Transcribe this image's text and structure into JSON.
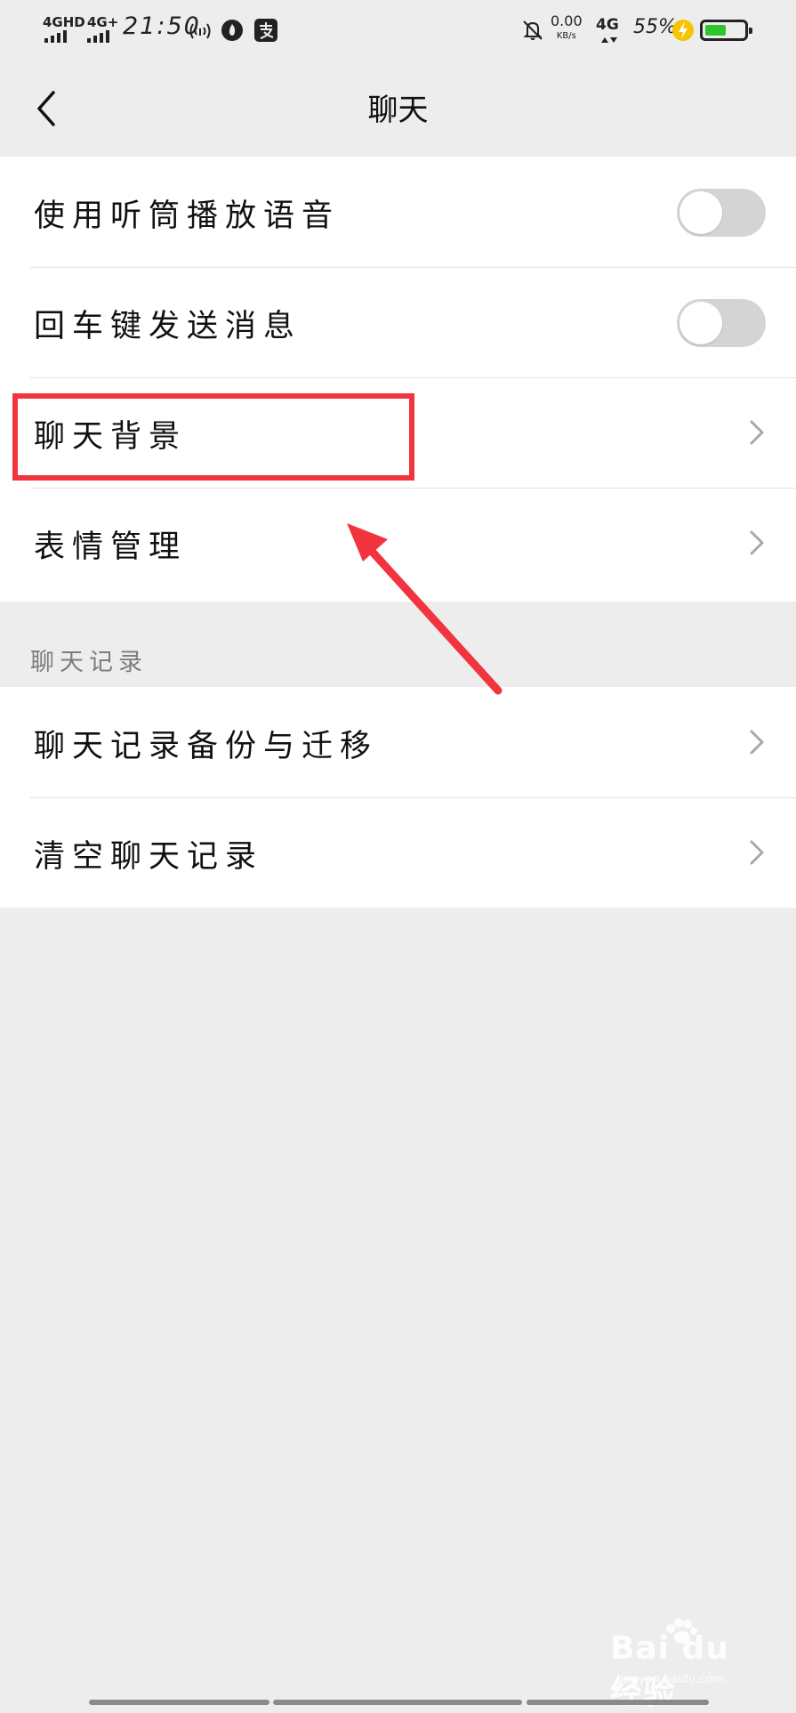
{
  "status_bar": {
    "network_1": "4GHD",
    "network_2": "4G+",
    "time": "21:50",
    "net_speed_value": "0.00",
    "net_speed_unit": "KB/s",
    "network_3": "4G",
    "battery_percent": "55%",
    "battery_level": 0.55,
    "battery_color": "#2ec52a",
    "icons": [
      "signal-icon",
      "signal-icon",
      "hotspot-icon",
      "fire-icon",
      "alipay-icon",
      "mute-bell-icon",
      "charging-icon",
      "battery-icon"
    ]
  },
  "nav": {
    "title": "聊天",
    "back_icon": "chevron-left-icon"
  },
  "settings_group_1": {
    "items": [
      {
        "label": "使用听筒播放语音",
        "control": "toggle",
        "on": false
      },
      {
        "label": "回车键发送消息",
        "control": "toggle",
        "on": false
      },
      {
        "label": "聊天背景",
        "control": "chevron"
      },
      {
        "label": "表情管理",
        "control": "chevron"
      }
    ]
  },
  "chat_history_section": {
    "header": "聊天记录",
    "items": [
      {
        "label": "聊天记录备份与迁移",
        "control": "chevron"
      },
      {
        "label": "清空聊天记录",
        "control": "chevron"
      }
    ]
  },
  "annotation": {
    "highlight_color": "#f2343f"
  },
  "watermark": {
    "main": "Bai du 经验",
    "sub": "jingyan.baidu.com"
  }
}
